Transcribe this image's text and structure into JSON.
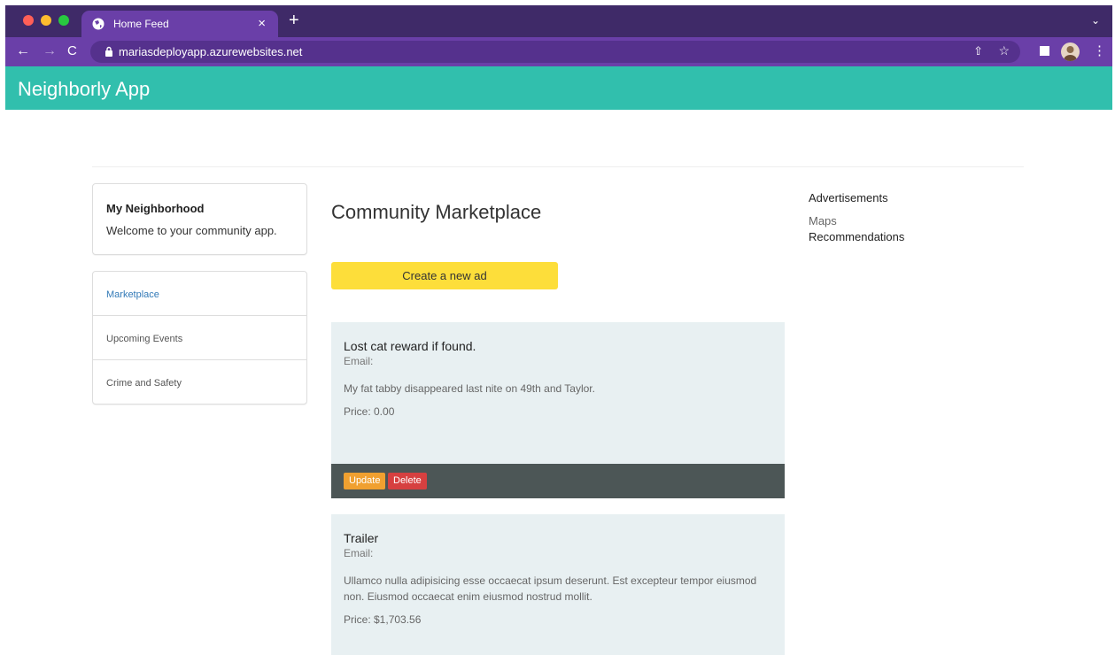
{
  "browser": {
    "tab_title": "Home Feed",
    "tab_close": "×",
    "new_tab": "+",
    "tab_menu": "⌄",
    "url": "mariasdeployapp.azurewebsites.net",
    "nav": {
      "back": "←",
      "forward": "→",
      "reload": "C"
    },
    "actions": {
      "share": "⇧",
      "bookmark": "☆",
      "menu": "⋮"
    },
    "traffic_colors": [
      "#ff5f57",
      "#febc2e",
      "#28c840"
    ],
    "accent": "#6a3fa8"
  },
  "app": {
    "brand": "Neighborly App",
    "header_color": "#31bfad"
  },
  "sidebar": {
    "neighborhood": {
      "title": "My Neighborhood",
      "text": "Welcome to your community app."
    },
    "items": [
      {
        "label": "Marketplace",
        "active": true
      },
      {
        "label": "Upcoming Events"
      },
      {
        "label": "Crime and Safety"
      }
    ]
  },
  "main": {
    "title": "Community Marketplace",
    "create_button": "Create a new ad",
    "ads": [
      {
        "title": "Lost cat reward if found.",
        "email_label": "Email:",
        "description": "My fat tabby disappeared last nite on 49th and Taylor.",
        "price": "Price: 0.00",
        "update_label": "Update",
        "delete_label": "Delete"
      },
      {
        "title": "Trailer",
        "email_label": "Email:",
        "description": "Ullamco nulla adipisicing esse occaecat ipsum deserunt. Est excepteur tempor eiusmod non. Eiusmod occaecat enim eiusmod nostrud mollit.",
        "price": "Price: $1,703.56"
      }
    ]
  },
  "right": {
    "title": "Advertisements",
    "links": [
      "Maps",
      "Recommendations"
    ]
  }
}
